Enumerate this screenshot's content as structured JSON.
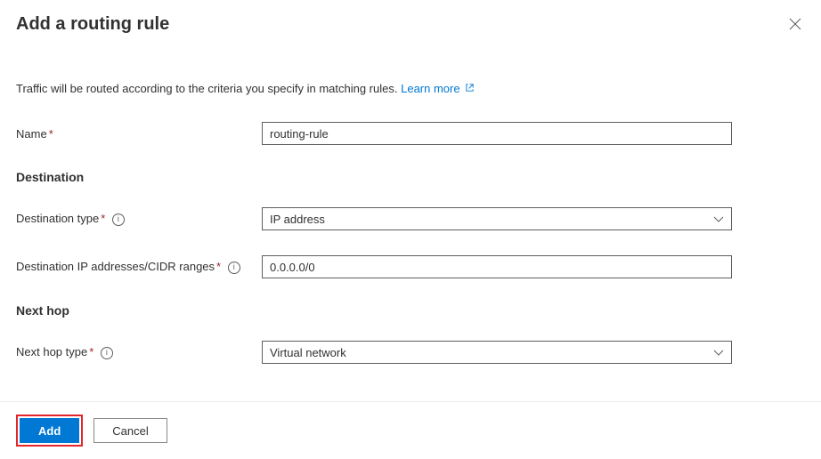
{
  "header": {
    "title": "Add a routing rule"
  },
  "description": {
    "text": "Traffic will be routed according to the criteria you specify in matching rules.",
    "learn_more": "Learn more"
  },
  "form": {
    "name": {
      "label": "Name",
      "value": "routing-rule"
    }
  },
  "destination": {
    "section_title": "Destination",
    "type": {
      "label": "Destination type",
      "value": "IP address"
    },
    "ip_ranges": {
      "label": "Destination IP addresses/CIDR ranges",
      "value": "0.0.0.0/0"
    }
  },
  "next_hop": {
    "section_title": "Next hop",
    "type": {
      "label": "Next hop type",
      "value": "Virtual network"
    }
  },
  "footer": {
    "add_label": "Add",
    "cancel_label": "Cancel"
  }
}
